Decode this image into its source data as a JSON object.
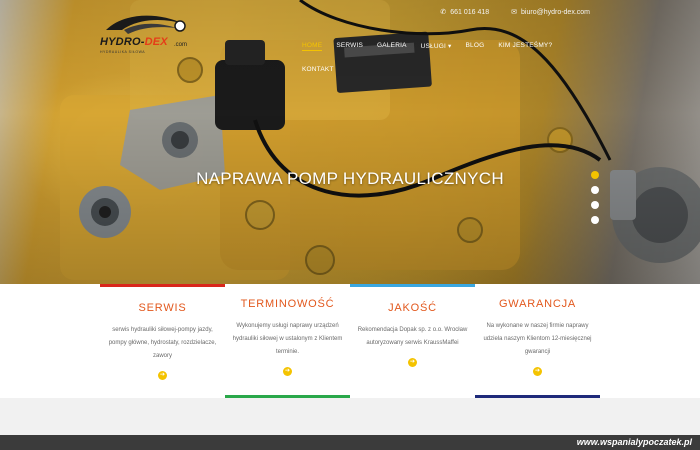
{
  "topbar": {
    "phone": "661 016 418",
    "email": "biuro@hydro-dex.com"
  },
  "logo": {
    "name_part1": "HYDRO-",
    "name_part2": "DEX",
    "domain": ".com",
    "subtitle": "HYDRAULIKA SIŁOWA"
  },
  "nav": {
    "items": [
      {
        "label": "HOME"
      },
      {
        "label": "SERWIS"
      },
      {
        "label": "GALERIA"
      },
      {
        "label": "USŁUGI"
      },
      {
        "label": "BLOG"
      },
      {
        "label": "KIM JESTEŚMY?"
      },
      {
        "label": "KONTAKT"
      }
    ]
  },
  "hero": {
    "title": "NAPRAWA POMP HYDRAULICZNYCH"
  },
  "features": [
    {
      "title": "SERWIS",
      "text": "serwis hydrauliki siłowej-pompy jazdy, pompy główne, hydrostaty, rozdzielacze, zawory",
      "accent": "#d9261c"
    },
    {
      "title": "TERMINOWOŚĆ",
      "text": "Wykonujemy usługi naprawy urządzeń hydrauliki siłowej w ustalonym z Klientem terminie.",
      "accent": "#2aa84a"
    },
    {
      "title": "JAKOŚĆ",
      "text": "Rekomendacja Dopak sp. z o.o. Wrocław autoryzowany serwis KraussMaffei",
      "accent": "#3aa7e0"
    },
    {
      "title": "GWARANCJA",
      "text": "Na wykonane w naszej firmie naprawy udziela naszym Klientom 12-miesięcznej gwarancji",
      "accent": "#1e2a7a"
    }
  ],
  "watermark": "www.wspanialypoczatek.pl",
  "colors": {
    "accent_yellow": "#f4c300",
    "feature_title": "#e2581d"
  }
}
